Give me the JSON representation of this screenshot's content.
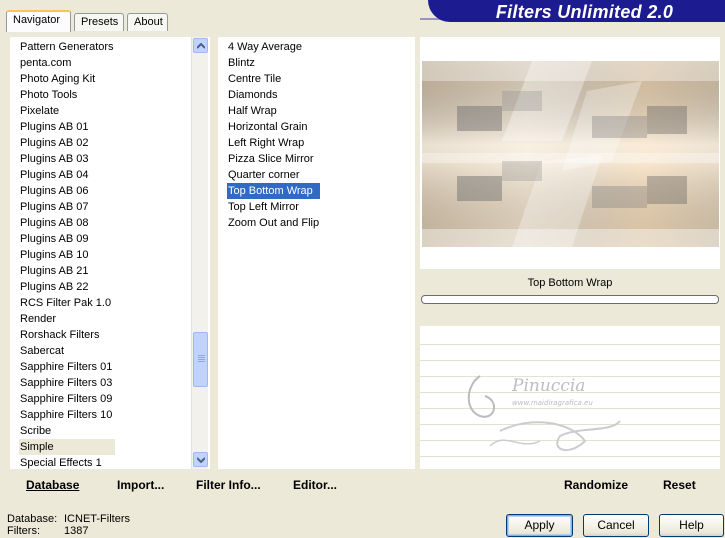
{
  "tabs": [
    {
      "label": "Navigator",
      "active": true
    },
    {
      "label": "Presets",
      "active": false
    },
    {
      "label": "About",
      "active": false
    }
  ],
  "banner": {
    "title": "Filters Unlimited 2.0"
  },
  "categories": {
    "items": [
      "Pattern Generators",
      "penta.com",
      "Photo Aging Kit",
      "Photo Tools",
      "Pixelate",
      "Plugins AB 01",
      "Plugins AB 02",
      "Plugins AB 03",
      "Plugins AB 04",
      "Plugins AB 06",
      "Plugins AB 07",
      "Plugins AB 08",
      "Plugins AB 09",
      "Plugins AB 10",
      "Plugins AB 21",
      "Plugins AB 22",
      "RCS Filter Pak 1.0",
      "Render",
      "Rorshack Filters",
      "Sabercat",
      "Sapphire Filters 01",
      "Sapphire Filters 03",
      "Sapphire Filters 09",
      "Sapphire Filters 10",
      "Scribe",
      "Simple",
      "Special Effects 1"
    ],
    "selected": "Simple"
  },
  "filters": {
    "items": [
      "4 Way Average",
      "Blintz",
      "Centre Tile",
      "Diamonds",
      "Half Wrap",
      "Horizontal Grain",
      "Left Right Wrap",
      "Pizza Slice Mirror",
      "Quarter corner",
      "Top Bottom Wrap",
      "Top Left Mirror",
      "Zoom Out and Flip"
    ],
    "selected": "Top Bottom Wrap"
  },
  "preview": {
    "filter_name": "Top Bottom Wrap",
    "watermark_text": "Pinuccia",
    "watermark_url": "www.maidiragrafica.eu"
  },
  "buttons": {
    "database": "Database",
    "import": "Import...",
    "filter_info": "Filter Info...",
    "editor": "Editor...",
    "randomize": "Randomize",
    "reset": "Reset",
    "apply": "Apply",
    "cancel": "Cancel",
    "help": "Help"
  },
  "status": {
    "database_label": "Database:",
    "database_value": "ICNET-Filters",
    "filters_label": "Filters:",
    "filters_value": "1387"
  },
  "colors": {
    "banner": "#1c1c90",
    "selection": "#316ac5",
    "scrollbar": "#c1d3fb"
  }
}
